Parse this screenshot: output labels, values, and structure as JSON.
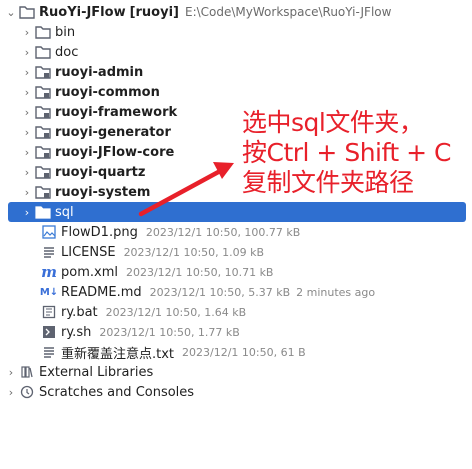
{
  "project": {
    "name": "RuoYi-JFlow",
    "module": "[ruoyi]",
    "path": "E:\\Code\\MyWorkspace\\RuoYi-JFlow"
  },
  "folders": [
    {
      "label": "bin",
      "bold": false
    },
    {
      "label": "doc",
      "bold": false
    },
    {
      "label": "ruoyi-admin",
      "bold": true
    },
    {
      "label": "ruoyi-common",
      "bold": true
    },
    {
      "label": "ruoyi-framework",
      "bold": true
    },
    {
      "label": "ruoyi-generator",
      "bold": true
    },
    {
      "label": "ruoyi-JFlow-core",
      "bold": true
    },
    {
      "label": "ruoyi-quartz",
      "bold": true
    },
    {
      "label": "ruoyi-system",
      "bold": true
    },
    {
      "label": "sql",
      "bold": false,
      "selected": true
    }
  ],
  "files": [
    {
      "label": "FlowD1.png",
      "meta": "2023/12/1 10:50, 100.77 kB",
      "icon": "image-file-icon"
    },
    {
      "label": "LICENSE",
      "meta": "2023/12/1 10:50, 1.09 kB",
      "icon": "text-file-icon"
    },
    {
      "label": "pom.xml",
      "meta": "2023/12/1 10:50, 10.71 kB",
      "icon": "maven-icon"
    },
    {
      "label": "README.md",
      "meta": "2023/12/1 10:50, 5.37 kB",
      "extra": "2 minutes ago",
      "icon": "markdown-icon"
    },
    {
      "label": "ry.bat",
      "meta": "2023/12/1 10:50, 1.64 kB",
      "icon": "bat-file-icon"
    },
    {
      "label": "ry.sh",
      "meta": "2023/12/1 10:50, 1.77 kB",
      "icon": "shell-file-icon"
    },
    {
      "label": "重新覆盖注意点.txt",
      "meta": "2023/12/1 10:50, 61 B",
      "icon": "text-file-icon"
    }
  ],
  "bottom": {
    "external_libraries": "External Libraries",
    "scratches": "Scratches and Consoles"
  },
  "annotation": {
    "line1": "选中sql文件夹，",
    "line2": "按Ctrl + Shift + C",
    "line3": "复制文件夹路径",
    "color": "#e8202a"
  },
  "colors": {
    "selection": "#2f6fd0",
    "folder": "#5e6370"
  }
}
